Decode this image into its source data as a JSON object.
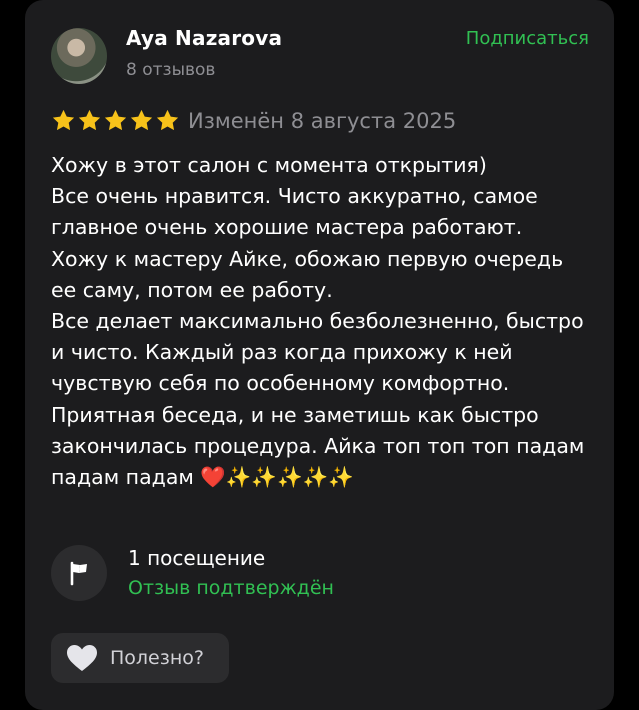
{
  "review": {
    "author_name": "Aya Nazarova",
    "author_reviews": "8 отзывов",
    "subscribe_label": "Подписаться",
    "rating": 5,
    "date_text": "Изменён 8 августа 2025",
    "text": "Хожу в этот салон с момента открытия)\nВсе очень нравится. Чисто аккуратно, самое главное очень хорошие мастера работают.\nХожу к мастеру Айке, обожаю первую очередь ее саму, потом ее работу.\nВсе делает максимально безболезненно, быстро и чисто. Каждый раз когда прихожу к ней чувствую себя по особенному комфортно.\nПриятная беседа, и не заметишь как быстро закончилась процедура. Айка топ топ топ падам падам падам ❤️✨✨✨✨✨",
    "visits": "1 посещение",
    "verified": "Отзыв подтверждён",
    "helpful_label": "Полезно?"
  },
  "icons": {
    "avatar": "user-avatar",
    "star": "star-icon",
    "visit": "flag-icon",
    "helpful": "heart-icon"
  },
  "colors": {
    "background": "#000000",
    "card": "#1c1c1e",
    "accent_green": "#31c053",
    "star": "#f7c21a",
    "muted_text": "#8e8e93",
    "button_bg": "#2c2c2e"
  }
}
